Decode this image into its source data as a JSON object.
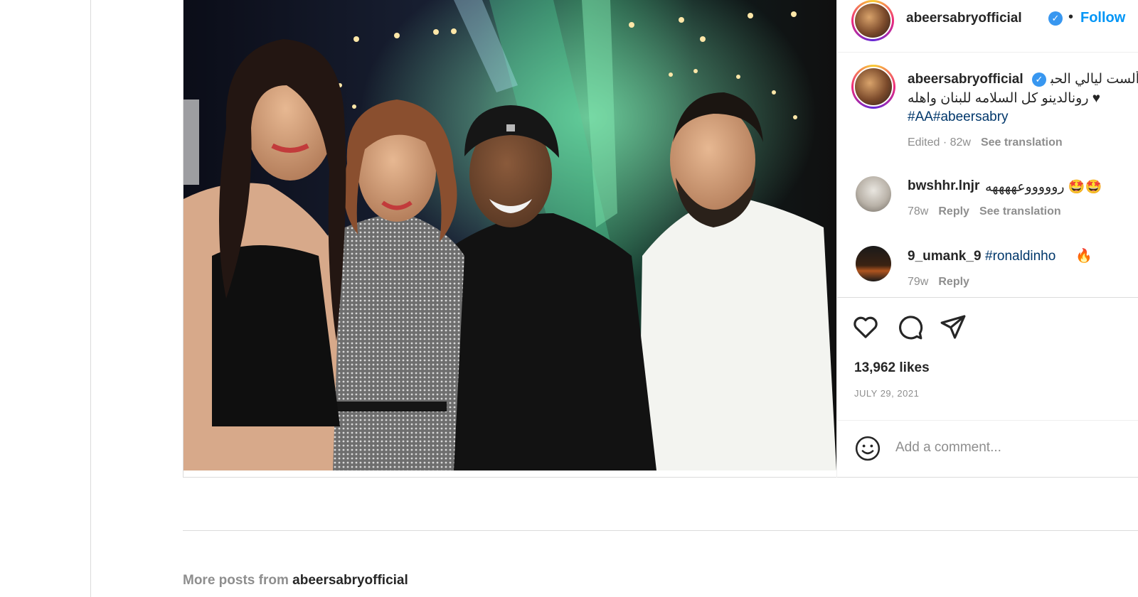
{
  "post": {
    "username": "abeersabryofficial",
    "follow_label": "Follow",
    "dot": "•",
    "verified_mark": "✓"
  },
  "caption": {
    "username": "abeersabryofficial",
    "text_line1": "ألست ليالي الحبيبه مع",
    "text_line2": "♥ رونالدينو كل السلامه للبنان واهله",
    "hashtags": "#AA#abeersabry",
    "edited": "Edited · 82w",
    "see_translation": "See translation"
  },
  "comments": [
    {
      "username": "bwshhr.lnjr",
      "text": "🤩🤩 روووووعههههه",
      "time": "78w",
      "reply": "Reply",
      "see_translation": "See translation"
    },
    {
      "username": "9_umank_9",
      "text": "#ronaldinho",
      "emoji": "🔥",
      "time": "79w",
      "reply": "Reply"
    }
  ],
  "likes": "13,962 likes",
  "date": "JULY 29, 2021",
  "add_comment_placeholder": "Add a comment...",
  "more_posts": {
    "prefix": "More posts from",
    "username": "abeersabryofficial"
  },
  "icons": [
    "heart-icon",
    "comment-icon",
    "share-icon",
    "emoji-icon",
    "verified-badge-icon"
  ],
  "colors": {
    "link_blue": "#0095f6",
    "hashtag": "#00376b",
    "muted": "#8e8e8e"
  }
}
